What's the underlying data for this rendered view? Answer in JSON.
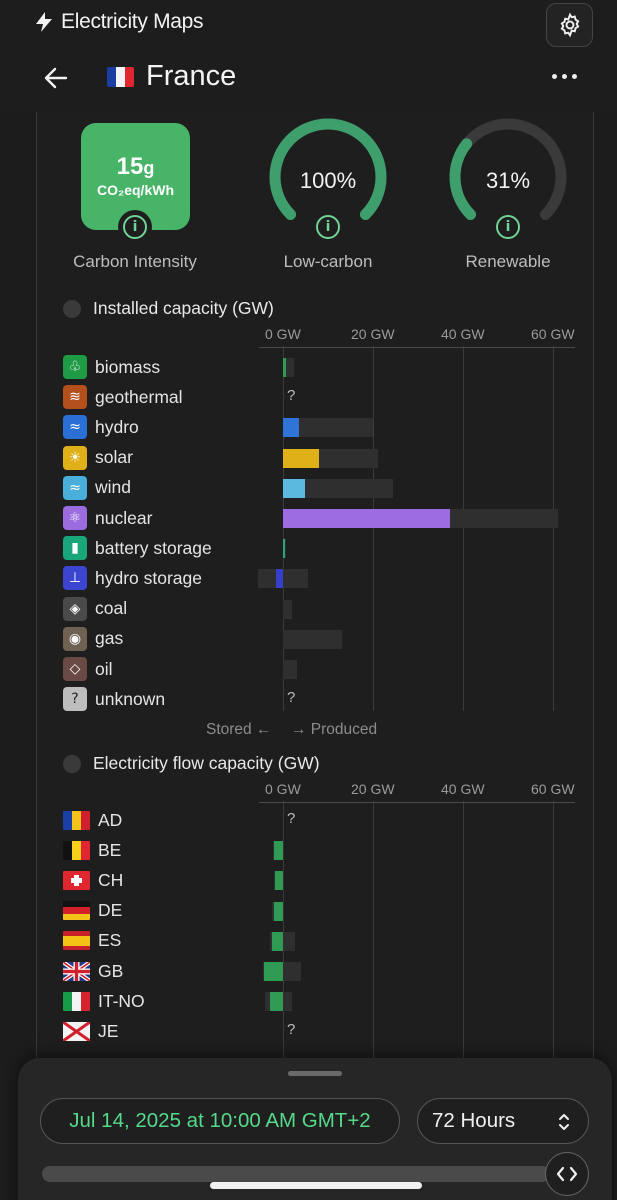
{
  "app": {
    "title": "Electricity Maps"
  },
  "zone": {
    "name": "France"
  },
  "metrics": {
    "carbon_intensity": {
      "value": "15",
      "unit_suffix": "g",
      "unit": "CO₂eq/kWh",
      "label": "Carbon Intensity"
    },
    "low_carbon": {
      "value": "100%",
      "label": "Low-carbon",
      "fraction": 1.0
    },
    "renewable": {
      "value": "31%",
      "label": "Renewable",
      "fraction": 0.31
    }
  },
  "colors": {
    "accent": "#47b468",
    "gauge_fill": "#3f9f6c",
    "gauge_track": "#3a3a3a",
    "date_text": "#55d98a"
  },
  "capacity": {
    "title": "Installed capacity (GW)",
    "axis": [
      "0 GW",
      "20 GW",
      "40 GW",
      "60 GW"
    ],
    "axis_max": 60,
    "stored_label": "Stored ←",
    "produced_label": "→ Produced",
    "rows": [
      {
        "name": "biomass",
        "icon": "leaf-icon",
        "icon_color": "#1f9a45",
        "icon_glyph": "♧",
        "produced": 0.6,
        "capacity": 2.5,
        "bar_color": "#2e9a54"
      },
      {
        "name": "geothermal",
        "icon": "heat-waves-icon",
        "icon_color": "#b4501c",
        "icon_glyph": "≋",
        "unknown": "?"
      },
      {
        "name": "hydro",
        "icon": "water-icon",
        "icon_color": "#2a6fd6",
        "icon_glyph": "≈",
        "produced": 3.5,
        "capacity": 20,
        "bar_color": "#2f74d6"
      },
      {
        "name": "solar",
        "icon": "sun-icon",
        "icon_color": "#e0b018",
        "icon_glyph": "☀",
        "produced": 8,
        "capacity": 21,
        "bar_color": "#e0b018"
      },
      {
        "name": "wind",
        "icon": "wind-icon",
        "icon_color": "#4aaedb",
        "icon_glyph": "≈",
        "produced": 4.8,
        "capacity": 24.5,
        "bar_color": "#5bb8de"
      },
      {
        "name": "nuclear",
        "icon": "atom-icon",
        "icon_color": "#9b6be0",
        "icon_glyph": "⚛",
        "produced": 37,
        "capacity": 61,
        "bar_color": "#9d6ce3"
      },
      {
        "name": "battery storage",
        "icon": "battery-icon",
        "icon_color": "#1aa67a",
        "icon_glyph": "▮",
        "produced": 0.2,
        "capacity": 0.5,
        "bar_color": "#2aa57a"
      },
      {
        "name": "hydro storage",
        "icon": "pumped-hydro-icon",
        "icon_color": "#3b45d0",
        "icon_glyph": "⊥",
        "produced": -1.5,
        "stored_capacity": 5.5,
        "capacity": 5.5,
        "bar_color": "#3540c8"
      },
      {
        "name": "coal",
        "icon": "coal-drop-icon",
        "icon_color": "#4a4a4a",
        "icon_glyph": "◈",
        "produced": 0,
        "capacity": 2
      },
      {
        "name": "gas",
        "icon": "flame-icon",
        "icon_color": "#6f6253",
        "icon_glyph": "◉",
        "produced": 0.3,
        "capacity": 13
      },
      {
        "name": "oil",
        "icon": "oil-drop-icon",
        "icon_color": "#6a4a44",
        "icon_glyph": "◇",
        "produced": 0,
        "capacity": 3
      },
      {
        "name": "unknown",
        "icon": "question-icon",
        "icon_color": "#bdbdbd",
        "icon_glyph": "?",
        "unknown": "?"
      }
    ]
  },
  "flows": {
    "title": "Electricity flow capacity (GW)",
    "axis": [
      "0 GW",
      "20 GW",
      "40 GW",
      "60 GW"
    ],
    "axis_max": 60,
    "rows": [
      {
        "name": "AD",
        "flag": "andorra-flag",
        "unknown": "?"
      },
      {
        "name": "BE",
        "flag": "belgium-flag",
        "export": 2,
        "import_cap": 0.2,
        "export_cap": 2.2
      },
      {
        "name": "CH",
        "flag": "switzerland-flag",
        "export": 1.7,
        "import_cap": 0.2,
        "export_cap": 2
      },
      {
        "name": "DE",
        "flag": "germany-flag",
        "export": 2.1,
        "import_cap": 0.3,
        "export_cap": 2.4
      },
      {
        "name": "ES",
        "flag": "spain-flag",
        "export": 2.4,
        "import_cap": 2.6,
        "export_cap": 2.8
      },
      {
        "name": "GB",
        "flag": "uk-flag",
        "export": 4.3,
        "import_cap": 4,
        "export_cap": 4.4
      },
      {
        "name": "IT-NO",
        "flag": "italy-flag",
        "export": 3,
        "import_cap": 2,
        "export_cap": 4
      },
      {
        "name": "JE",
        "flag": "jersey-flag",
        "unknown": "?"
      }
    ]
  },
  "timeline": {
    "datetime": "Jul 14, 2025 at 10:00 AM GMT+2",
    "range": "72 Hours"
  }
}
